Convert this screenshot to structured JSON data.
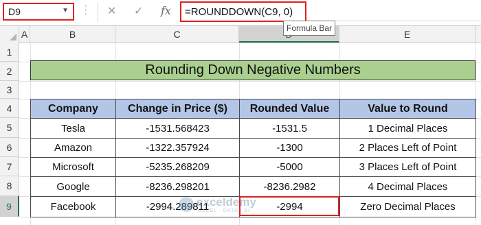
{
  "formula_bar": {
    "name_box": "D9",
    "formula": "=ROUNDDOWN(C9, 0)",
    "tooltip": "Formula Bar",
    "icons": [
      "cancel-icon",
      "enter-icon",
      "insert-function-icon"
    ]
  },
  "columns": [
    "A",
    "B",
    "C",
    "D",
    "E"
  ],
  "rows": [
    "1",
    "2",
    "3",
    "4",
    "5",
    "6",
    "7",
    "8",
    "9"
  ],
  "selected_cell": {
    "column": "D",
    "row": "9"
  },
  "sheet": {
    "title": "Rounding Down Negative Numbers",
    "title_color": "#a9d08e",
    "header_color": "#b4c6e7",
    "headers": [
      "Company",
      "Change in Price ($)",
      "Rounded Value",
      "Value to Round"
    ],
    "rows": [
      [
        "Tesla",
        "-1531.568423",
        "-1531.5",
        "1 Decimal Places"
      ],
      [
        "Amazon",
        "-1322.357924",
        "-1300",
        "2 Places Left of Point"
      ],
      [
        "Microsoft",
        "-5235.268209",
        "-5000",
        "3 Places Left of Point"
      ],
      [
        "Google",
        "-8236.298201",
        "-8236.2982",
        "4 Decimal Places"
      ],
      [
        "Facebook",
        "-2994.289811",
        "-2994",
        "Zero Decimal Places"
      ]
    ]
  },
  "watermark": {
    "name": "exceldemy",
    "tagline": "EXCEL · DATA · BI"
  },
  "accent_colors": {
    "highlight_border": "#e02020",
    "selected_header": "#217346"
  }
}
